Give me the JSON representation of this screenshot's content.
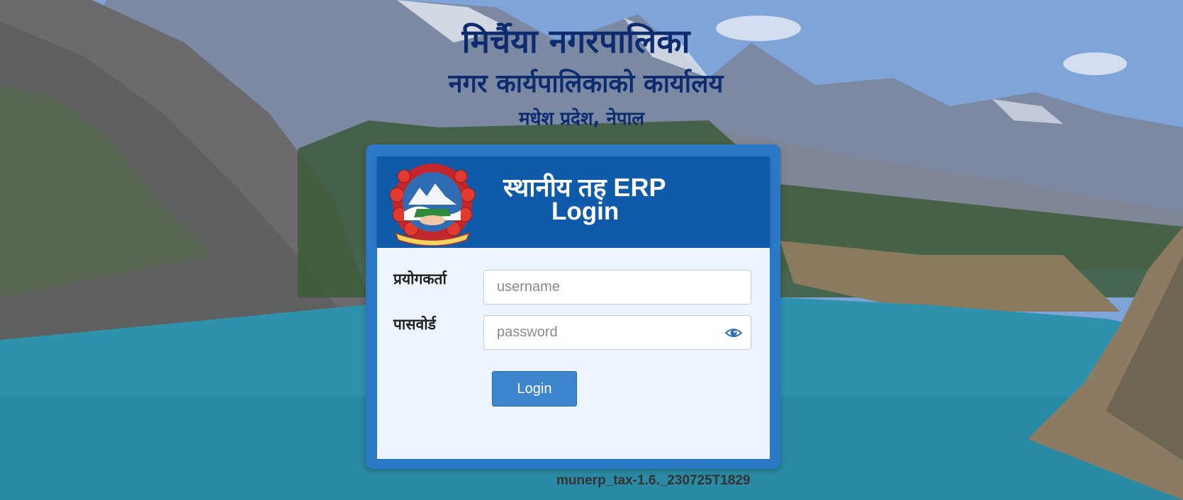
{
  "header": {
    "municipality": "मिर्चैया नगरपालिका",
    "office": "नगर कार्यपालिकाको कार्यालय",
    "location": "मधेश प्रदेश, नेपाल"
  },
  "login_card": {
    "title": "स्थानीय तह ERP",
    "subtitle": "Login",
    "emblem_icon": "nepal-government-emblem",
    "username_label": "प्रयोगकर्ता",
    "username_placeholder": "username",
    "password_label": "पासवोर्ड",
    "password_placeholder": "password",
    "password_toggle_icon": "eye-icon",
    "login_button": "Login"
  },
  "footer": {
    "version": "munerp_tax-1.6._230725T1829"
  },
  "colors": {
    "header_text": "#0d2c6f",
    "card_frame": "#2b78c6",
    "card_header": "#0f5aa9",
    "button": "#3d85cc"
  }
}
